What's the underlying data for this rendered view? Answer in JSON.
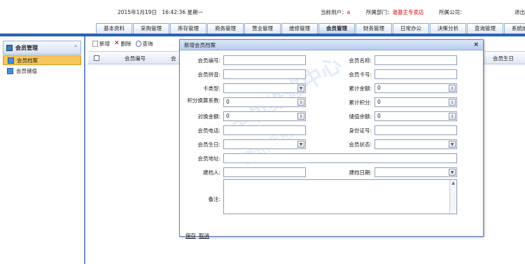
{
  "header": {
    "datetime": "2015年1月19日　16:42:36 星期一",
    "current_user_label": "当前用户：",
    "current_user_value": "a",
    "dept_label": "所属部门：",
    "dept_value": "谐基正专卖店",
    "company_label": "所属公司：",
    "logout": "退出"
  },
  "tabs": [
    "基本资料",
    "采购管理",
    "库存管理",
    "商务管理",
    "营业管理",
    "维修管理",
    "会员管理",
    "财务管理",
    "日常办公",
    "决策分析",
    "查询管理",
    "系统维护"
  ],
  "sidebar": {
    "title": "会员管理",
    "items": [
      {
        "label": "会员档案",
        "active": true
      },
      {
        "label": "会员储值",
        "active": false
      }
    ]
  },
  "toolbar": {
    "new": "新增",
    "delete": "删除",
    "query": "查询"
  },
  "grid": {
    "col_member_no": "会员编号",
    "col_member_name": "会",
    "col_birthday": "会员生日"
  },
  "dialog": {
    "title": "新增会员档案",
    "close": "×",
    "fields": {
      "member_no": "会员编号:",
      "member_name": "会员名称:",
      "member_pinyin": "会员拼音:",
      "member_card": "会员卡号:",
      "card_type": "卡类型:",
      "total_amount": "累计金额:",
      "total_amount_value": "0",
      "points_coef": "积分换算系数:",
      "points_coef_value": "0",
      "total_points": "累计积分:",
      "total_points_value": "0",
      "exchange_amount": "对换金额:",
      "exchange_amount_value": "0",
      "balance": "储值余额:",
      "balance_value": "0",
      "phone": "会员电话:",
      "id_card": "身份证号:",
      "birthday": "会员生日:",
      "status": "会员状态:",
      "address": "会员地址:",
      "creator": "建档人:",
      "create_date": "建档日期:",
      "remark": "备注:"
    },
    "save": "保存",
    "cancel": "取消"
  },
  "watermark": {
    "line1": "手机维修中心",
    "line2": "通讯专用"
  }
}
